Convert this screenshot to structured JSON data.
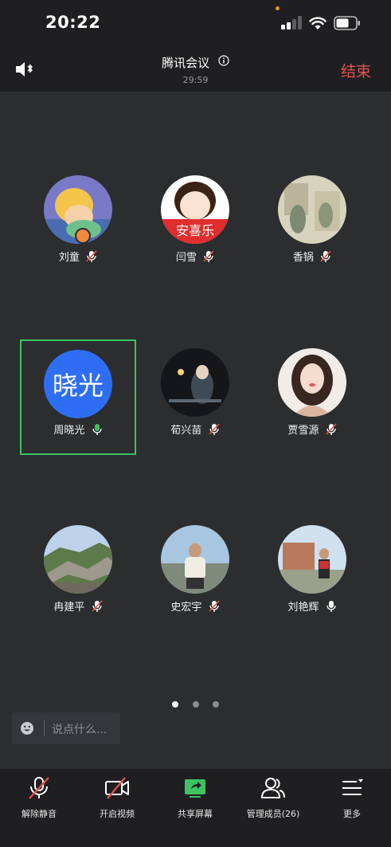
{
  "status_bar": {
    "time": "20:22"
  },
  "header": {
    "title": "腾讯会议",
    "timer": "29:59",
    "end_label": "结束"
  },
  "participants": [
    {
      "name": "刘童",
      "mic": "muted",
      "avatar": "cartoon-fairy",
      "host": true
    },
    {
      "name": "闫雪",
      "mic": "muted",
      "avatar": "cartoon-girl-red"
    },
    {
      "name": "香锅",
      "mic": "muted",
      "avatar": "vintage-painting"
    },
    {
      "name": "周晓光",
      "mic": "on",
      "avatar_text": "晓光",
      "active_speaker": true
    },
    {
      "name": "荀兴苗",
      "mic": "muted",
      "avatar": "night-girl"
    },
    {
      "name": "贾雪源",
      "mic": "muted",
      "avatar": "illustrated-girl"
    },
    {
      "name": "冉建平",
      "mic": "muted",
      "avatar": "great-wall"
    },
    {
      "name": "史宏宇",
      "mic": "muted",
      "avatar": "man-outdoors"
    },
    {
      "name": "刘艳辉",
      "mic": "on",
      "avatar": "building-photo"
    }
  ],
  "pager": {
    "pages": 3,
    "current": 1
  },
  "chat": {
    "placeholder": "说点什么..."
  },
  "toolbar": {
    "unmute": "解除静音",
    "video": "开启视频",
    "share": "共享屏幕",
    "members": "管理成员(26)",
    "more": "更多"
  },
  "colors": {
    "end": "#e5534b",
    "active_border": "#3ec262",
    "share_icon": "#3ec262",
    "avatar_blue": "#2d6ef5"
  }
}
